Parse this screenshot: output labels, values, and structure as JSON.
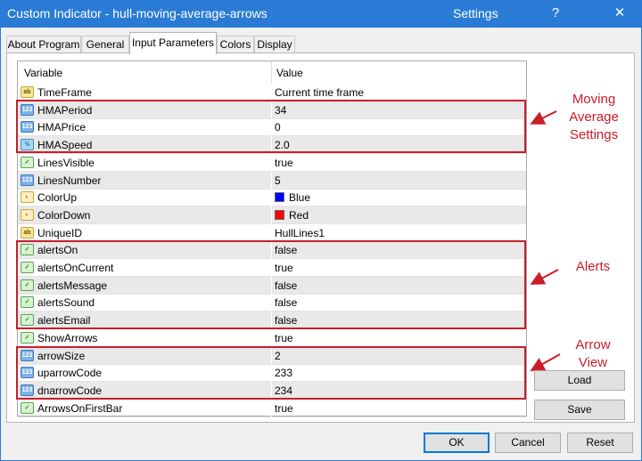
{
  "window": {
    "title": "Custom Indicator - hull-moving-average-arrows",
    "dialog_name": "Settings",
    "help_label": "?",
    "close_label": "✕"
  },
  "tabs": [
    {
      "label": "About Program"
    },
    {
      "label": "General"
    },
    {
      "label": "Input Parameters",
      "active": true
    },
    {
      "label": "Colors"
    },
    {
      "label": "Display"
    }
  ],
  "grid": {
    "header": {
      "variable": "Variable",
      "value": "Value"
    },
    "rows": [
      {
        "icon": "ab",
        "icon_name": "string-type-icon",
        "name": "TimeFrame",
        "value": "Current time frame"
      },
      {
        "icon": "123",
        "icon_name": "integer-type-icon",
        "name": "HMAPeriod",
        "value": "34"
      },
      {
        "icon": "123",
        "icon_name": "integer-type-icon",
        "name": "HMAPrice",
        "value": "0"
      },
      {
        "icon": "½",
        "icon_name": "double-type-icon",
        "name": "HMASpeed",
        "value": "2.0"
      },
      {
        "icon": "✓",
        "icon_name": "bool-type-icon",
        "name": "LinesVisible",
        "value": "true"
      },
      {
        "icon": "123",
        "icon_name": "integer-type-icon",
        "name": "LinesNumber",
        "value": "5"
      },
      {
        "icon": "◐",
        "icon_name": "color-type-icon",
        "name": "ColorUp",
        "value": "Blue",
        "swatch": "#0000ff"
      },
      {
        "icon": "◐",
        "icon_name": "color-type-icon",
        "name": "ColorDown",
        "value": "Red",
        "swatch": "#ff0000"
      },
      {
        "icon": "ab",
        "icon_name": "string-type-icon",
        "name": "UniqueID",
        "value": "HullLines1"
      },
      {
        "icon": "✓",
        "icon_name": "bool-type-icon",
        "name": "alertsOn",
        "value": "false"
      },
      {
        "icon": "✓",
        "icon_name": "bool-type-icon",
        "name": "alertsOnCurrent",
        "value": "true"
      },
      {
        "icon": "✓",
        "icon_name": "bool-type-icon",
        "name": "alertsMessage",
        "value": "false"
      },
      {
        "icon": "✓",
        "icon_name": "bool-type-icon",
        "name": "alertsSound",
        "value": "false"
      },
      {
        "icon": "✓",
        "icon_name": "bool-type-icon",
        "name": "alertsEmail",
        "value": "false"
      },
      {
        "icon": "✓",
        "icon_name": "bool-type-icon",
        "name": "ShowArrows",
        "value": "true"
      },
      {
        "icon": "123",
        "icon_name": "integer-type-icon",
        "name": "arrowSize",
        "value": "2"
      },
      {
        "icon": "123",
        "icon_name": "integer-type-icon",
        "name": "uparrowCode",
        "value": "233"
      },
      {
        "icon": "123",
        "icon_name": "integer-type-icon",
        "name": "dnarrowCode",
        "value": "234"
      },
      {
        "icon": "✓",
        "icon_name": "bool-type-icon",
        "name": "ArrowsOnFirstBar",
        "value": "true"
      }
    ]
  },
  "annotations": {
    "moving_average": "Moving Average Settings",
    "alerts": "Alerts",
    "arrow_view": "Arrow View",
    "color": "#c81e2a"
  },
  "side_buttons": {
    "load": "Load",
    "save": "Save"
  },
  "footer_buttons": {
    "ok": "OK",
    "cancel": "Cancel",
    "reset": "Reset"
  },
  "colors": {
    "titlebar": "#2a7bd5",
    "highlight": "#c81e2a"
  }
}
